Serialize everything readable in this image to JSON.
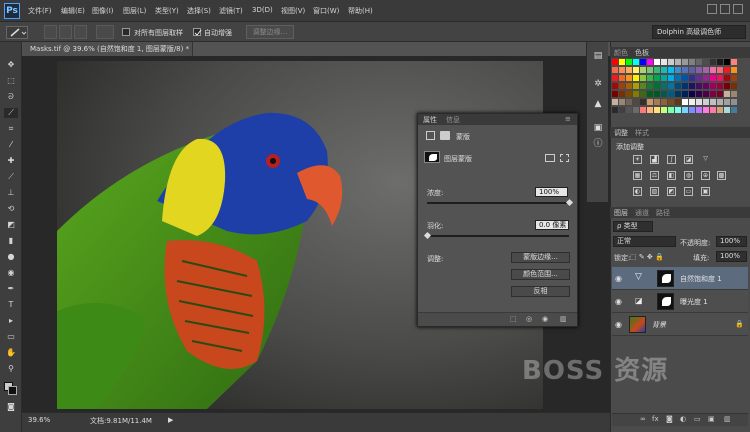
{
  "app": {
    "logo": "Ps"
  },
  "menu": [
    "文件(F)",
    "编辑(E)",
    "图像(I)",
    "图层(L)",
    "类型(Y)",
    "选择(S)",
    "滤镜(T)",
    "3D(D)",
    "视图(V)",
    "窗口(W)",
    "帮助(H)"
  ],
  "options": {
    "sample_all": "对所有图层取样",
    "auto_enhance": "自动增强",
    "refine_edge": "调整边缘...",
    "workspace": "Dolphin 高级调色师"
  },
  "document": {
    "tab_title": "Masks.tif @ 39.6% (自然饱和度 1, 图层蒙版/8) *",
    "zoom": "39.6%",
    "doc_size": "文档:9.81M/11.4M"
  },
  "properties": {
    "tabs": [
      "属性",
      "信息"
    ],
    "mask_title": "蒙版",
    "layer_mask": "图层蒙版",
    "density_label": "浓度:",
    "density_value": "100%",
    "density": 1.0,
    "feather_label": "羽化:",
    "feather_value": "0.0 像素",
    "feather": 0.0,
    "refine_label": "调整:",
    "btn_mask_edge": "蒙版边缘...",
    "btn_color_range": "颜色范围...",
    "btn_invert": "反相"
  },
  "dock": {
    "color_tabs": [
      "颜色",
      "色板"
    ],
    "adj_tabs": [
      "调整",
      "样式"
    ],
    "adj_title": "添加调整",
    "layer_tabs": [
      "图层",
      "通道",
      "路径"
    ],
    "kind_select": "ρ 类型",
    "blend_mode": "正常",
    "opacity_label": "不透明度:",
    "opacity_value": "100%",
    "lock_label": "锁定:",
    "fill_label": "填充:",
    "fill_value": "100%",
    "layers": [
      {
        "name": "自然饱和度 1"
      },
      {
        "name": "曝光度 1"
      },
      {
        "name": "背景"
      }
    ]
  },
  "colors": {
    "accent": "#4da3ff"
  },
  "watermark": "BOSS 资源"
}
